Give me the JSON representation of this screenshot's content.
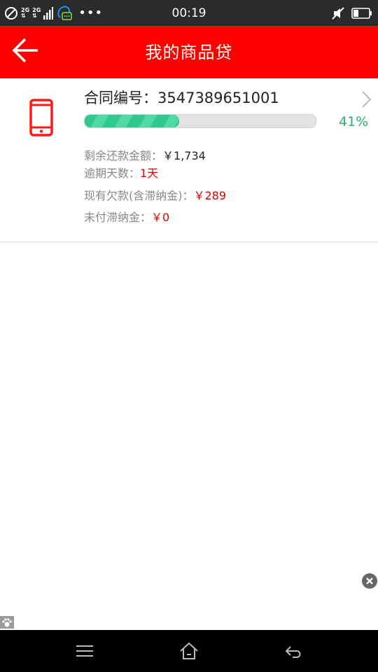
{
  "status_bar": {
    "time": "00:19",
    "network_1": "2G",
    "network_2": "2G",
    "icons": [
      "no-disturb-icon",
      "signal-icon",
      "qq-notify-icon",
      "more-dots-icon",
      "mute-icon",
      "battery-icon"
    ]
  },
  "header": {
    "title": "我的商品贷",
    "back_icon": "back-arrow-icon"
  },
  "loan": {
    "icon": "phone-icon",
    "contract_label": "合同编号：",
    "contract_no": "3547389651001",
    "progress_percent": 41,
    "progress_text": "41%",
    "remaining_label": "剩余还款金额：",
    "remaining_value": "￥1,734",
    "overdue_days_label": "逾期天数：",
    "overdue_days_value": "1天",
    "current_debt_label": "现有欠款(含滞纳金)：",
    "current_debt_value": "￥289",
    "unpaid_fee_label": "未付滞纳金：",
    "unpaid_fee_value": "￥0"
  },
  "nav_bar": {
    "icons": [
      "menu-icon",
      "home-icon",
      "back-icon"
    ]
  },
  "colors": {
    "header": "#ff0000",
    "progress": "#2ec98e",
    "percent": "#2eaf6a",
    "alert": "#e00000"
  }
}
